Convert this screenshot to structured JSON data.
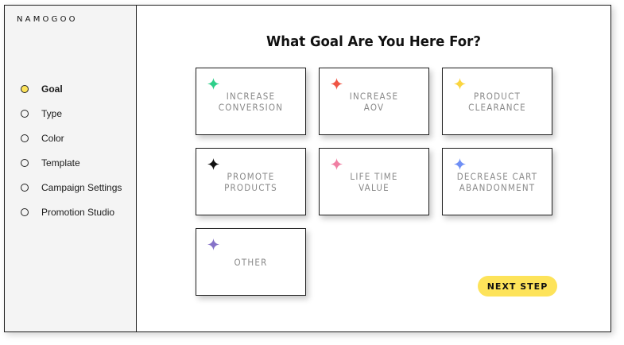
{
  "brand": {
    "logo": "NAMOGOO"
  },
  "sidebar": {
    "steps": [
      {
        "label": "Goal",
        "active": true
      },
      {
        "label": "Type"
      },
      {
        "label": "Color"
      },
      {
        "label": "Template"
      },
      {
        "label": "Campaign Settings"
      },
      {
        "label": "Promotion Studio"
      }
    ]
  },
  "main": {
    "title": "What Goal Are You Here For?",
    "goals": [
      {
        "label": "INCREASE\nCONVERSION",
        "color": "#2ecf8a"
      },
      {
        "label": "INCREASE\nAOV",
        "color": "#f05545"
      },
      {
        "label": "PRODUCT\nCLEARANCE",
        "color": "#fbd53f"
      },
      {
        "label": "PROMOTE\nPRODUCTS",
        "color": "#111111"
      },
      {
        "label": "LIFE TIME\nVALUE",
        "color": "#f07fa3"
      },
      {
        "label": "DECREASE CART\nABANDONMENT",
        "color": "#6f8ff5"
      },
      {
        "label": "OTHER",
        "color": "#8572c8"
      }
    ],
    "next_label": "NEXT STEP"
  },
  "colors": {
    "accent": "#fde35a",
    "border": "#1f1f1f",
    "sidebar_bg": "#f4f4f4",
    "card_text": "#8a8a8a"
  },
  "icons": {
    "goal_icon": "sparkle-icon",
    "step_icon": "radio-circle-icon"
  }
}
